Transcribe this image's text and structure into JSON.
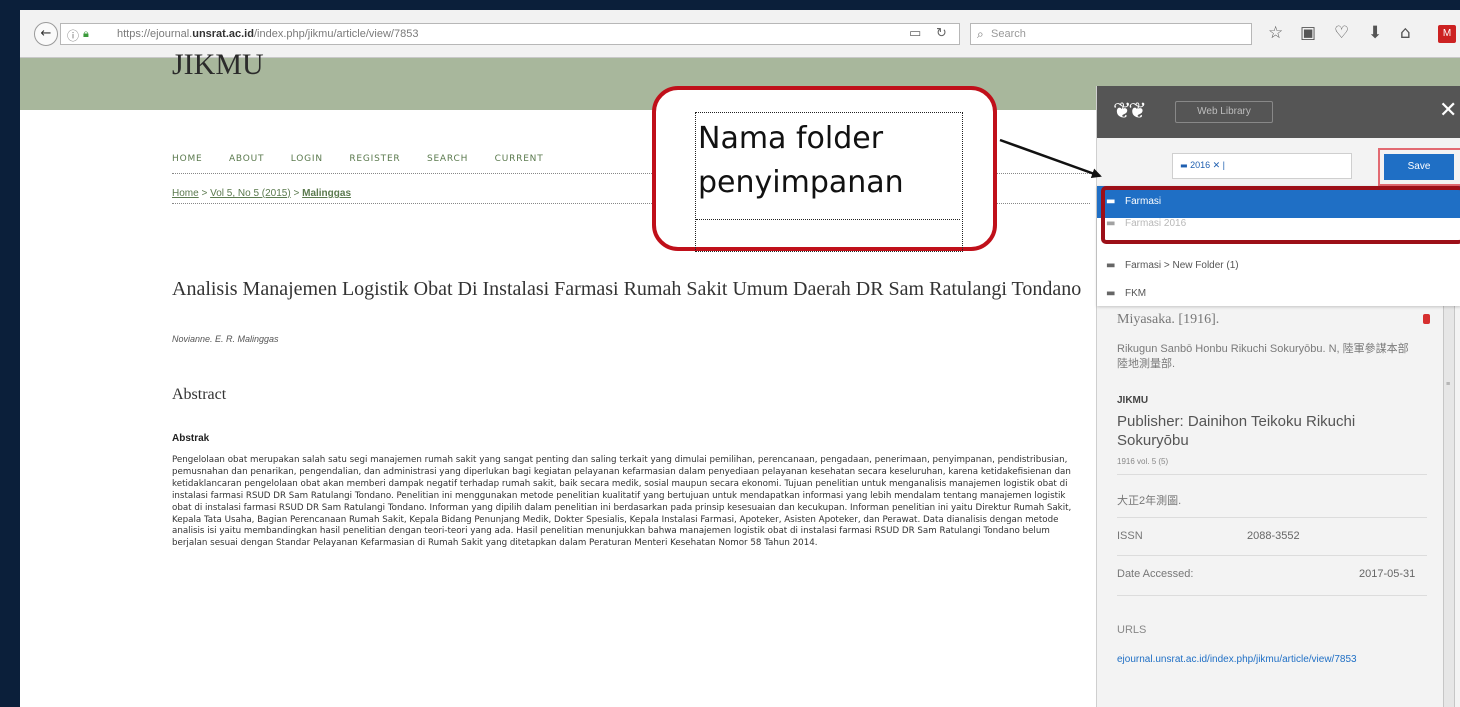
{
  "browser": {
    "url_prefix": "https://ejournal.",
    "url_domain": "unsrat.ac.id",
    "url_path": "/index.php/jikmu/article/view/7853",
    "search_placeholder": "Search"
  },
  "site": {
    "title": "JIKMU",
    "nav": [
      "HOME",
      "ABOUT",
      "LOGIN",
      "REGISTER",
      "SEARCH",
      "CURRENT"
    ],
    "breadcrumb": {
      "home": "Home",
      "sep": ">",
      "issue": "Vol 5, No 5 (2015)",
      "current": "Malinggas"
    }
  },
  "article": {
    "title": "Analisis Manajemen Logistik Obat Di Instalasi Farmasi Rumah Sakit Umum Daerah DR Sam Ratulangi Tondano",
    "authors": "Novianne. E. R. Malinggas",
    "abstract_heading": "Abstract",
    "abstrak_label": "Abstrak",
    "abstract_text": "Pengelolaan obat merupakan salah satu segi manajemen rumah sakit yang sangat penting dan saling terkait yang dimulai pemilihan, perencanaan, pengadaan, penerimaan, penyimpanan, pendistribusian, pemusnahan dan penarikan, pengendalian, dan administrasi yang diperlukan bagi kegiatan pelayanan kefarmasian dalam penyediaan pelayanan kesehatan secara keseluruhan, karena ketidakefisienan dan ketidaklancaran pengelolaan obat akan memberi dampak negatif terhadap rumah sakit, baik secara medik, sosial maupun secara ekonomi. Tujuan penelitian untuk menganalisis manajemen logistik obat di instalasi farmasi RSUD DR Sam Ratulangi Tondano. Penelitian ini menggunakan metode penelitian kualitatif yang bertujuan untuk mendapatkan informasi yang lebih mendalam tentang manajemen logistik obat di instalasi farmasi RSUD DR Sam Ratulangi Tondano. Informan yang dipilih dalam penelitian ini berdasarkan pada prinsip kesesuaian dan kecukupan. Informan penelitian ini yaitu Direktur Rumah Sakit, Kepala Tata Usaha, Bagian Perencanaan Rumah Sakit, Kepala Bidang Penunjang Medik, Dokter Spesialis, Kepala Instalasi Farmasi, Apoteker, Asisten Apoteker, dan Perawat. Data dianalisis dengan metode analisis isi yaitu membandingkan hasil penelitian dengan teori-teori yang ada. Hasil penelitian menunjukkan bahwa manajemen logistik obat di instalasi farmasi RSUD DR Sam Ratulangi Tondano belum berjalan sesuai dengan Standar Pelayanan Kefarmasian di Rumah Sakit yang ditetapkan dalam Peraturan Menteri Kesehatan Nomor 58 Tahun 2014."
  },
  "callout": {
    "line1": "Nama folder",
    "line2": "penyimpanan"
  },
  "mendeley": {
    "web_library_label": "Web Library",
    "folder_tag": "2016",
    "save_label": "Save",
    "dropdown": [
      {
        "label": "Farmasi"
      },
      {
        "label": "Farmasi 2016"
      },
      {
        "label": "Farmasi > New Folder (1)"
      },
      {
        "label": "FKM"
      }
    ],
    "cut_title": "Miyasaka. [1916].",
    "author_line": "Rikugun Sanbō Honbu Rikuchi Sokuryōbu. N, 陸軍參謀本部陸地測量部.",
    "publication": "JIKMU",
    "publisher": "Publisher: Dainihon Teikoku Rikuchi Sokuryōbu",
    "volume": "1916 vol. 5 (5)",
    "notes": "大正2年測圖.",
    "issn_label": "ISSN",
    "issn_value": "2088-3552",
    "accessed_label": "Date Accessed:",
    "accessed_value": "2017-05-31",
    "urls_label": "URLS",
    "url": "ejournal.unsrat.ac.id/index.php/jikmu/article/view/7853"
  },
  "colors": {
    "header_green": "#a8b79c",
    "link_green": "#5b7a4e",
    "mendeley_blue": "#1f6fc5",
    "callout_red": "#c0101a"
  },
  "icons": [
    "back-arrow-icon",
    "info-icon",
    "lock-icon",
    "reader-view-icon",
    "reload-icon",
    "search-icon",
    "bookmark-star-icon",
    "clipboard-icon",
    "pocket-icon",
    "download-icon",
    "home-icon",
    "mendeley-extension-icon",
    "mendeley-logo-icon",
    "close-icon",
    "folder-icon"
  ]
}
